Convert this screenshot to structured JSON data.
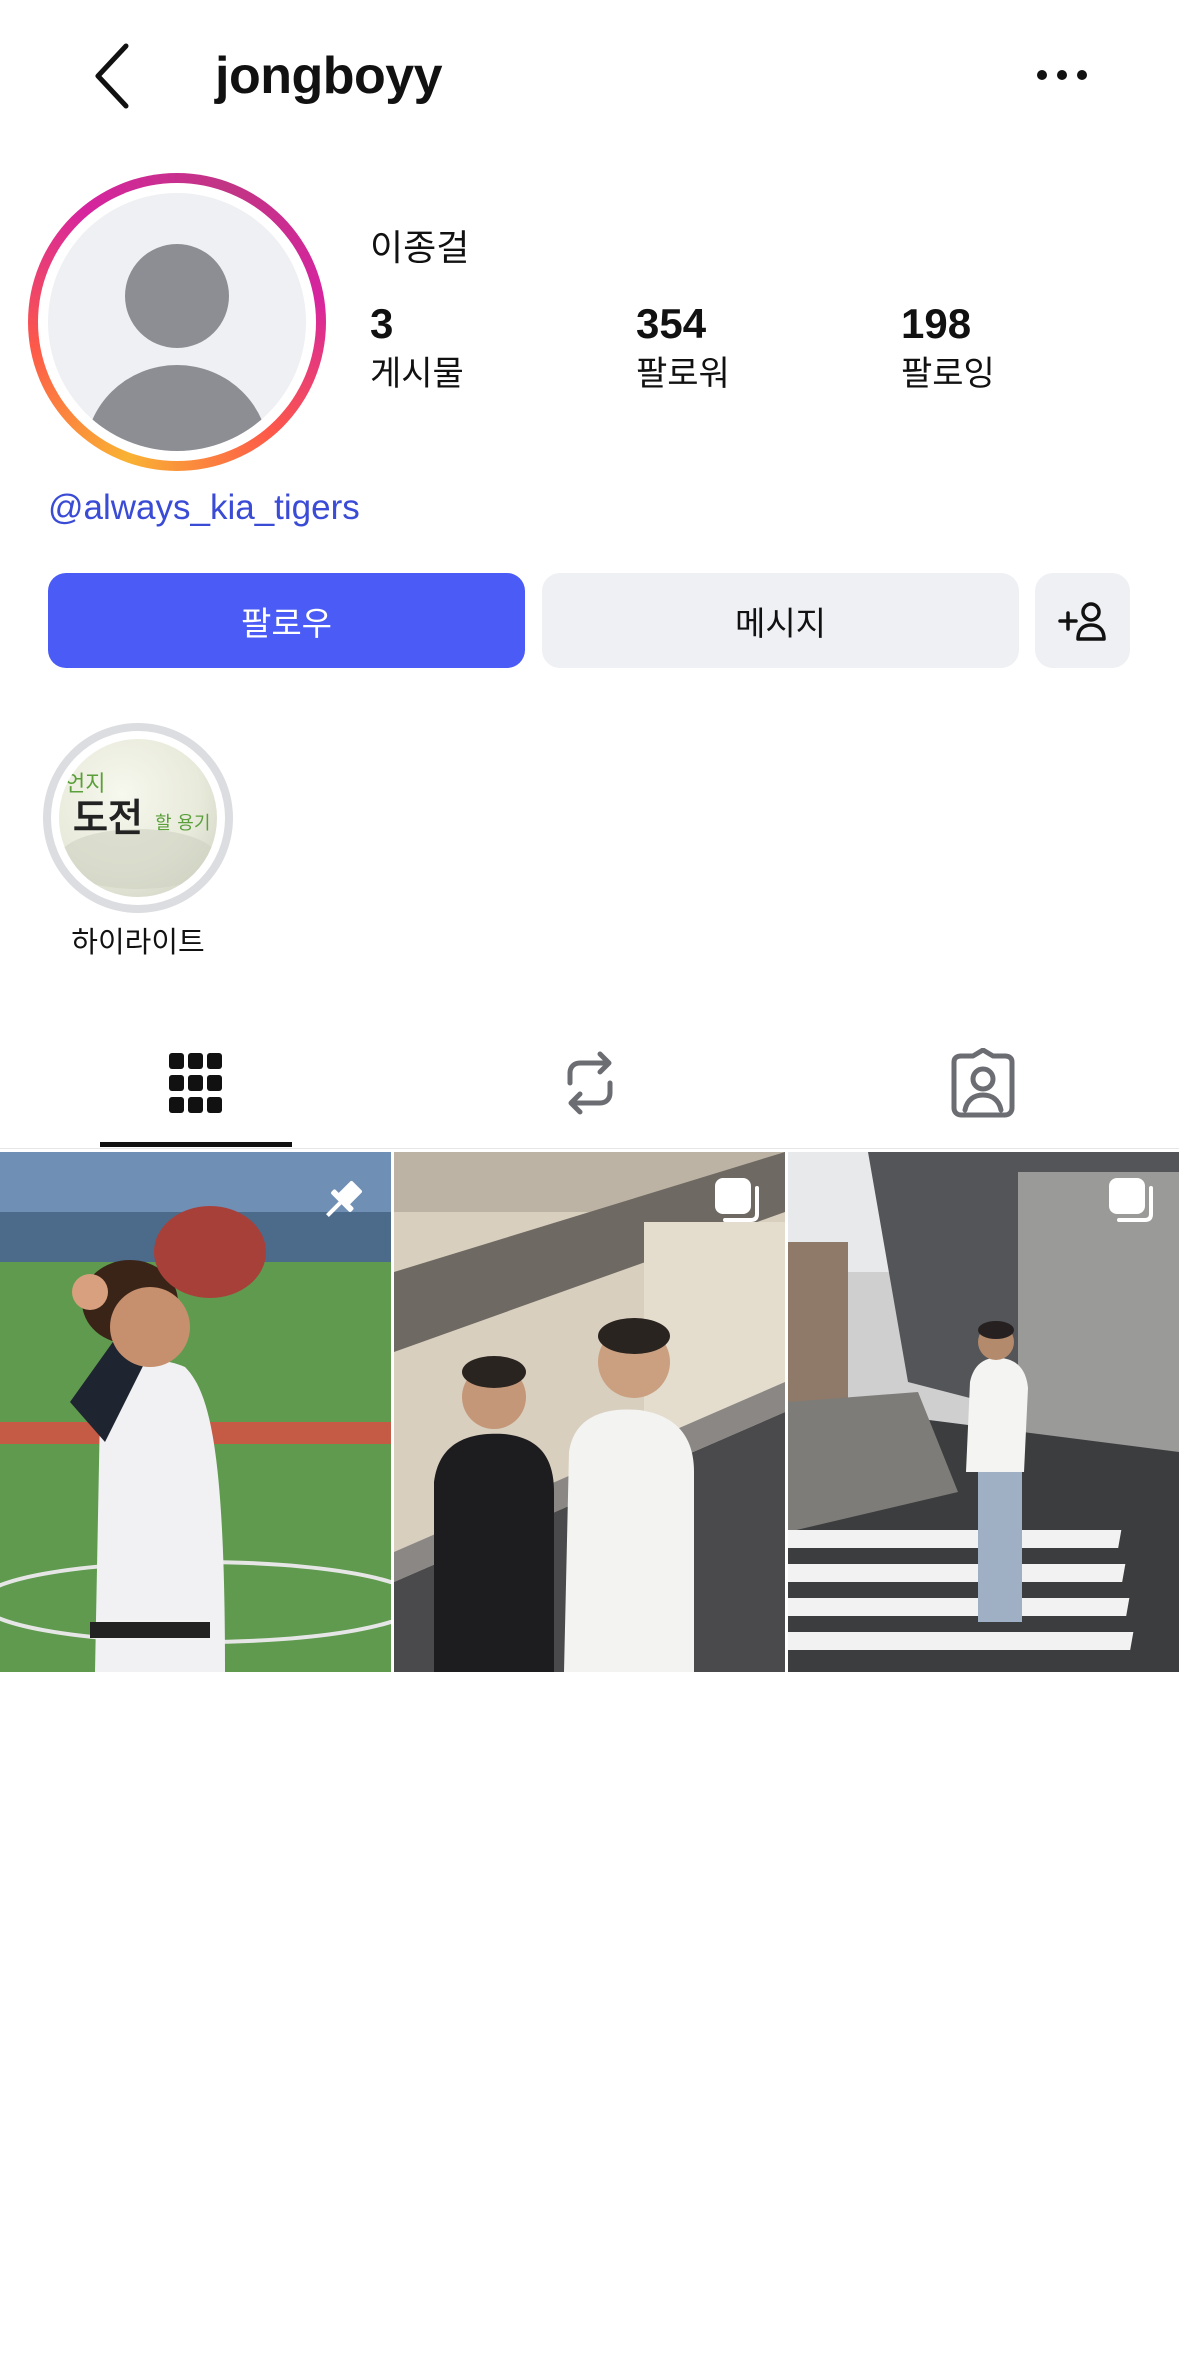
{
  "header": {
    "username": "jongboyy",
    "back_icon": "chevron-left-icon",
    "more_icon": "ellipsis-icon"
  },
  "profile": {
    "display_name": "이종걸",
    "stats": [
      {
        "value": "3",
        "label": "게시물"
      },
      {
        "value": "354",
        "label": "팔로워"
      },
      {
        "value": "198",
        "label": "팔로잉"
      }
    ],
    "bio_link": "@always_kia_tigers",
    "ring_colors": [
      "#f9b233",
      "#fd5949",
      "#d6249f"
    ]
  },
  "actions": {
    "follow_label": "팔로우",
    "message_label": "메시지",
    "add_icon": "add-person-icon",
    "follow_color": "#4a5cf5"
  },
  "highlights": [
    {
      "label": "하이라이트",
      "image_text": [
        "언지",
        "도전",
        "할 용기"
      ]
    }
  ],
  "tabs": [
    {
      "name": "posts",
      "icon": "grid-icon",
      "active": true
    },
    {
      "name": "reposts",
      "icon": "repost-icon",
      "active": false
    },
    {
      "name": "tagged",
      "icon": "tagged-icon",
      "active": false
    }
  ],
  "posts": [
    {
      "badge": "pin-icon"
    },
    {
      "badge": "multi-photo-icon"
    },
    {
      "badge": "multi-photo-icon"
    }
  ]
}
